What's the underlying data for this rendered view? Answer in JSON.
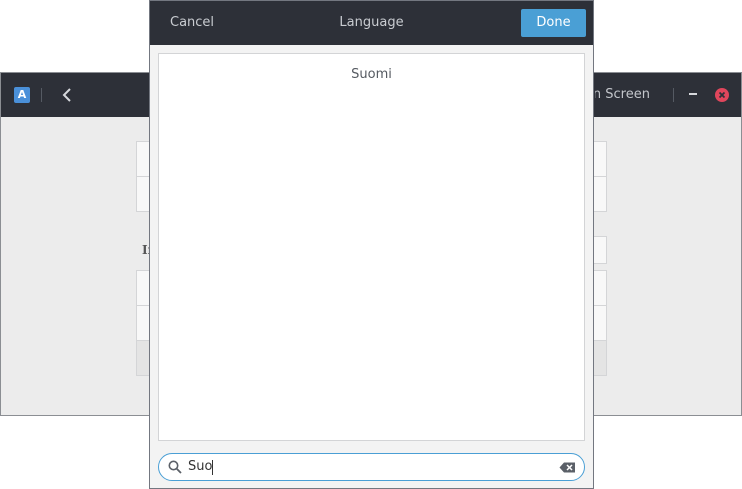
{
  "background_window": {
    "app_icon_letter": "A",
    "title_fragment": "gin Screen"
  },
  "dialog": {
    "cancel_label": "Cancel",
    "title": "Language",
    "done_label": "Done",
    "languages": [
      "Suomi"
    ],
    "search": {
      "value": "Suo",
      "placeholder": ""
    }
  },
  "colors": {
    "header_bg": "#2d3038",
    "accent": "#4a9fd5",
    "close": "#e0465c"
  }
}
